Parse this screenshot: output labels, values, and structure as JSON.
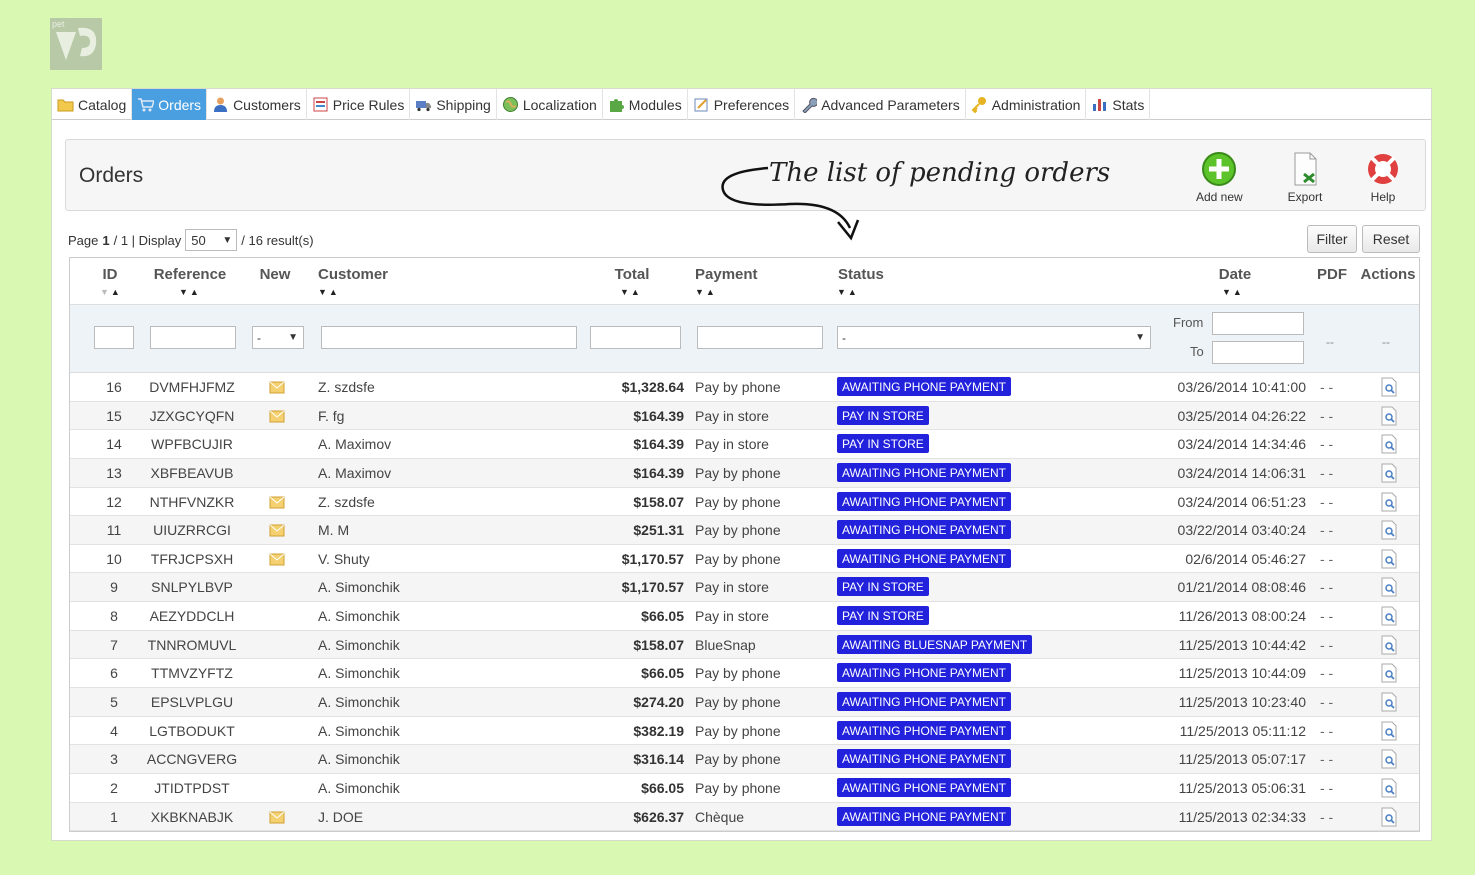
{
  "logo": {
    "icon": "prestashop-logo-icon"
  },
  "tabs": [
    {
      "label": "Catalog",
      "icon": "folder-icon",
      "active": false
    },
    {
      "label": "Orders",
      "icon": "cart-icon",
      "active": true
    },
    {
      "label": "Customers",
      "icon": "user-icon",
      "active": false
    },
    {
      "label": "Price Rules",
      "icon": "price-tag-icon",
      "active": false
    },
    {
      "label": "Shipping",
      "icon": "truck-icon",
      "active": false
    },
    {
      "label": "Localization",
      "icon": "globe-icon",
      "active": false
    },
    {
      "label": "Modules",
      "icon": "puzzle-icon",
      "active": false
    },
    {
      "label": "Preferences",
      "icon": "preferences-icon",
      "active": false
    },
    {
      "label": "Advanced Parameters",
      "icon": "wrench-icon",
      "active": false
    },
    {
      "label": "Administration",
      "icon": "key-icon",
      "active": false
    },
    {
      "label": "Stats",
      "icon": "bar-chart-icon",
      "active": false
    }
  ],
  "toolbar": {
    "title": "Orders",
    "annotation": "The list of pending orders",
    "add_new": "Add new",
    "export": "Export",
    "help": "Help"
  },
  "pagination": {
    "page_label": "Page",
    "current_page": "1",
    "pages_suffix": "/ 1 | Display",
    "per_page": "50",
    "results": "/ 16 result(s)"
  },
  "buttons": {
    "filter": "Filter",
    "reset": "Reset"
  },
  "columns": {
    "id": "ID",
    "reference": "Reference",
    "new": "New",
    "customer": "Customer",
    "total": "Total",
    "payment": "Payment",
    "status": "Status",
    "date": "Date",
    "pdf": "PDF",
    "actions": "Actions"
  },
  "filters": {
    "new_select": "-",
    "status_select": "-",
    "from_label": "From",
    "to_label": "To",
    "pdf_placeholder": "--",
    "actions_placeholder": "--"
  },
  "colors": {
    "status_badge": "#2222dd",
    "active_tab": "#4a9fe0",
    "background": "#d9f8b1"
  },
  "orders": [
    {
      "id": "16",
      "reference": "DVMFHJFMZ",
      "new": true,
      "customer": "Z. szdsfe",
      "total": "$1,328.64",
      "payment": "Pay by phone",
      "status": "AWAITING PHONE PAYMENT",
      "date": "03/26/2014 10:41:00",
      "pdf": "- -"
    },
    {
      "id": "15",
      "reference": "JZXGCYQFN",
      "new": true,
      "customer": "F. fg",
      "total": "$164.39",
      "payment": "Pay in store",
      "status": "PAY IN STORE",
      "date": "03/25/2014 04:26:22",
      "pdf": "- -"
    },
    {
      "id": "14",
      "reference": "WPFBCUJIR",
      "new": false,
      "customer": "A. Maximov",
      "total": "$164.39",
      "payment": "Pay in store",
      "status": "PAY IN STORE",
      "date": "03/24/2014 14:34:46",
      "pdf": "- -"
    },
    {
      "id": "13",
      "reference": "XBFBEAVUB",
      "new": false,
      "customer": "A. Maximov",
      "total": "$164.39",
      "payment": "Pay by phone",
      "status": "AWAITING PHONE PAYMENT",
      "date": "03/24/2014 14:06:31",
      "pdf": "- -"
    },
    {
      "id": "12",
      "reference": "NTHFVNZKR",
      "new": true,
      "customer": "Z. szdsfe",
      "total": "$158.07",
      "payment": "Pay by phone",
      "status": "AWAITING PHONE PAYMENT",
      "date": "03/24/2014 06:51:23",
      "pdf": "- -"
    },
    {
      "id": "11",
      "reference": "UIUZRRCGI",
      "new": true,
      "customer": "M. M",
      "total": "$251.31",
      "payment": "Pay by phone",
      "status": "AWAITING PHONE PAYMENT",
      "date": "03/22/2014 03:40:24",
      "pdf": "- -"
    },
    {
      "id": "10",
      "reference": "TFRJCPSXH",
      "new": true,
      "customer": "V. Shuty",
      "total": "$1,170.57",
      "payment": "Pay by phone",
      "status": "AWAITING PHONE PAYMENT",
      "date": "02/6/2014 05:46:27",
      "pdf": "- -"
    },
    {
      "id": "9",
      "reference": "SNLPYLBVP",
      "new": false,
      "customer": "A. Simonchik",
      "total": "$1,170.57",
      "payment": "Pay in store",
      "status": "PAY IN STORE",
      "date": "01/21/2014 08:08:46",
      "pdf": "- -"
    },
    {
      "id": "8",
      "reference": "AEZYDDCLH",
      "new": false,
      "customer": "A. Simonchik",
      "total": "$66.05",
      "payment": "Pay in store",
      "status": "PAY IN STORE",
      "date": "11/26/2013 08:00:24",
      "pdf": "- -"
    },
    {
      "id": "7",
      "reference": "TNNROMUVL",
      "new": false,
      "customer": "A. Simonchik",
      "total": "$158.07",
      "payment": "BlueSnap",
      "status": "AWAITING BLUESNAP PAYMENT",
      "date": "11/25/2013 10:44:42",
      "pdf": "- -"
    },
    {
      "id": "6",
      "reference": "TTMVZYFTZ",
      "new": false,
      "customer": "A. Simonchik",
      "total": "$66.05",
      "payment": "Pay by phone",
      "status": "AWAITING PHONE PAYMENT",
      "date": "11/25/2013 10:44:09",
      "pdf": "- -"
    },
    {
      "id": "5",
      "reference": "EPSLVPLGU",
      "new": false,
      "customer": "A. Simonchik",
      "total": "$274.20",
      "payment": "Pay by phone",
      "status": "AWAITING PHONE PAYMENT",
      "date": "11/25/2013 10:23:40",
      "pdf": "- -"
    },
    {
      "id": "4",
      "reference": "LGTBODUKT",
      "new": false,
      "customer": "A. Simonchik",
      "total": "$382.19",
      "payment": "Pay by phone",
      "status": "AWAITING PHONE PAYMENT",
      "date": "11/25/2013 05:11:12",
      "pdf": "- -"
    },
    {
      "id": "3",
      "reference": "ACCNGVERG",
      "new": false,
      "customer": "A. Simonchik",
      "total": "$316.14",
      "payment": "Pay by phone",
      "status": "AWAITING PHONE PAYMENT",
      "date": "11/25/2013 05:07:17",
      "pdf": "- -"
    },
    {
      "id": "2",
      "reference": "JTIDTPDST",
      "new": false,
      "customer": "A. Simonchik",
      "total": "$66.05",
      "payment": "Pay by phone",
      "status": "AWAITING PHONE PAYMENT",
      "date": "11/25/2013 05:06:31",
      "pdf": "- -"
    },
    {
      "id": "1",
      "reference": "XKBKNABJK",
      "new": true,
      "customer": "J. DOE",
      "total": "$626.37",
      "payment": "Chèque",
      "status": "AWAITING PHONE PAYMENT",
      "date": "11/25/2013 02:34:33",
      "pdf": "- -"
    }
  ]
}
